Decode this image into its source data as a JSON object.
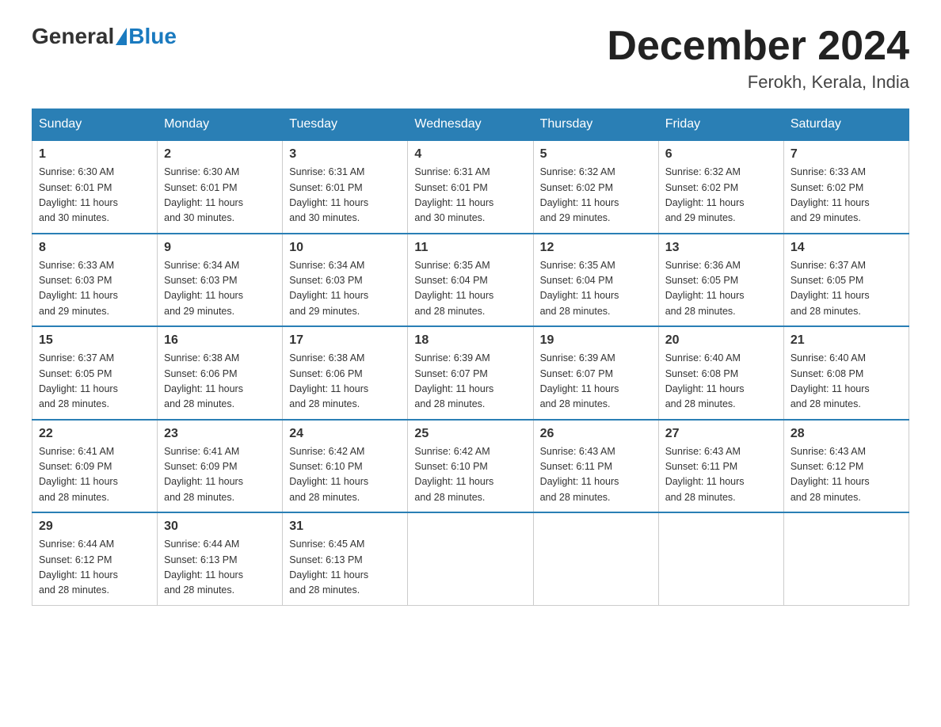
{
  "header": {
    "logo_general": "General",
    "logo_blue": "Blue",
    "title": "December 2024",
    "location": "Ferokh, Kerala, India"
  },
  "days_of_week": [
    "Sunday",
    "Monday",
    "Tuesday",
    "Wednesday",
    "Thursday",
    "Friday",
    "Saturday"
  ],
  "weeks": [
    [
      {
        "day": "1",
        "sunrise": "6:30 AM",
        "sunset": "6:01 PM",
        "daylight": "11 hours and 30 minutes."
      },
      {
        "day": "2",
        "sunrise": "6:30 AM",
        "sunset": "6:01 PM",
        "daylight": "11 hours and 30 minutes."
      },
      {
        "day": "3",
        "sunrise": "6:31 AM",
        "sunset": "6:01 PM",
        "daylight": "11 hours and 30 minutes."
      },
      {
        "day": "4",
        "sunrise": "6:31 AM",
        "sunset": "6:01 PM",
        "daylight": "11 hours and 30 minutes."
      },
      {
        "day": "5",
        "sunrise": "6:32 AM",
        "sunset": "6:02 PM",
        "daylight": "11 hours and 29 minutes."
      },
      {
        "day": "6",
        "sunrise": "6:32 AM",
        "sunset": "6:02 PM",
        "daylight": "11 hours and 29 minutes."
      },
      {
        "day": "7",
        "sunrise": "6:33 AM",
        "sunset": "6:02 PM",
        "daylight": "11 hours and 29 minutes."
      }
    ],
    [
      {
        "day": "8",
        "sunrise": "6:33 AM",
        "sunset": "6:03 PM",
        "daylight": "11 hours and 29 minutes."
      },
      {
        "day": "9",
        "sunrise": "6:34 AM",
        "sunset": "6:03 PM",
        "daylight": "11 hours and 29 minutes."
      },
      {
        "day": "10",
        "sunrise": "6:34 AM",
        "sunset": "6:03 PM",
        "daylight": "11 hours and 29 minutes."
      },
      {
        "day": "11",
        "sunrise": "6:35 AM",
        "sunset": "6:04 PM",
        "daylight": "11 hours and 28 minutes."
      },
      {
        "day": "12",
        "sunrise": "6:35 AM",
        "sunset": "6:04 PM",
        "daylight": "11 hours and 28 minutes."
      },
      {
        "day": "13",
        "sunrise": "6:36 AM",
        "sunset": "6:05 PM",
        "daylight": "11 hours and 28 minutes."
      },
      {
        "day": "14",
        "sunrise": "6:37 AM",
        "sunset": "6:05 PM",
        "daylight": "11 hours and 28 minutes."
      }
    ],
    [
      {
        "day": "15",
        "sunrise": "6:37 AM",
        "sunset": "6:05 PM",
        "daylight": "11 hours and 28 minutes."
      },
      {
        "day": "16",
        "sunrise": "6:38 AM",
        "sunset": "6:06 PM",
        "daylight": "11 hours and 28 minutes."
      },
      {
        "day": "17",
        "sunrise": "6:38 AM",
        "sunset": "6:06 PM",
        "daylight": "11 hours and 28 minutes."
      },
      {
        "day": "18",
        "sunrise": "6:39 AM",
        "sunset": "6:07 PM",
        "daylight": "11 hours and 28 minutes."
      },
      {
        "day": "19",
        "sunrise": "6:39 AM",
        "sunset": "6:07 PM",
        "daylight": "11 hours and 28 minutes."
      },
      {
        "day": "20",
        "sunrise": "6:40 AM",
        "sunset": "6:08 PM",
        "daylight": "11 hours and 28 minutes."
      },
      {
        "day": "21",
        "sunrise": "6:40 AM",
        "sunset": "6:08 PM",
        "daylight": "11 hours and 28 minutes."
      }
    ],
    [
      {
        "day": "22",
        "sunrise": "6:41 AM",
        "sunset": "6:09 PM",
        "daylight": "11 hours and 28 minutes."
      },
      {
        "day": "23",
        "sunrise": "6:41 AM",
        "sunset": "6:09 PM",
        "daylight": "11 hours and 28 minutes."
      },
      {
        "day": "24",
        "sunrise": "6:42 AM",
        "sunset": "6:10 PM",
        "daylight": "11 hours and 28 minutes."
      },
      {
        "day": "25",
        "sunrise": "6:42 AM",
        "sunset": "6:10 PM",
        "daylight": "11 hours and 28 minutes."
      },
      {
        "day": "26",
        "sunrise": "6:43 AM",
        "sunset": "6:11 PM",
        "daylight": "11 hours and 28 minutes."
      },
      {
        "day": "27",
        "sunrise": "6:43 AM",
        "sunset": "6:11 PM",
        "daylight": "11 hours and 28 minutes."
      },
      {
        "day": "28",
        "sunrise": "6:43 AM",
        "sunset": "6:12 PM",
        "daylight": "11 hours and 28 minutes."
      }
    ],
    [
      {
        "day": "29",
        "sunrise": "6:44 AM",
        "sunset": "6:12 PM",
        "daylight": "11 hours and 28 minutes."
      },
      {
        "day": "30",
        "sunrise": "6:44 AM",
        "sunset": "6:13 PM",
        "daylight": "11 hours and 28 minutes."
      },
      {
        "day": "31",
        "sunrise": "6:45 AM",
        "sunset": "6:13 PM",
        "daylight": "11 hours and 28 minutes."
      },
      null,
      null,
      null,
      null
    ]
  ]
}
